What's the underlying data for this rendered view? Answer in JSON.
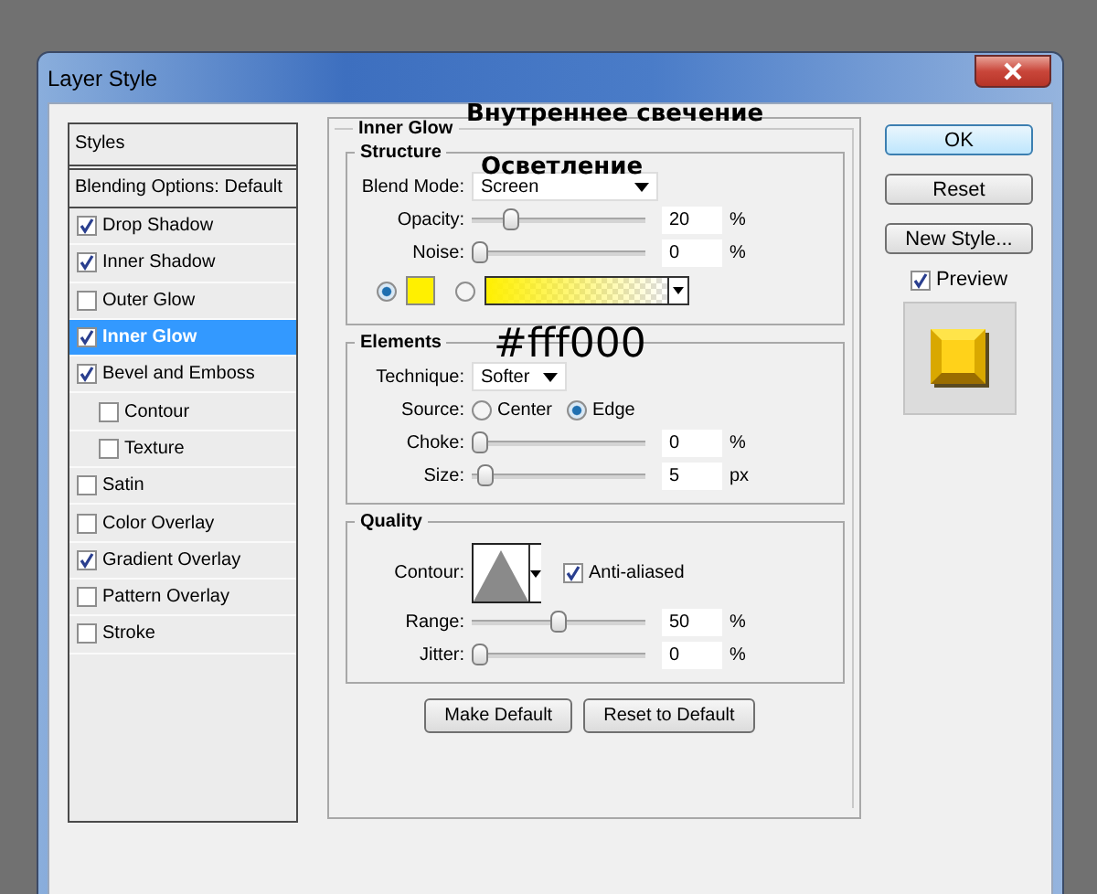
{
  "window": {
    "title": "Layer Style"
  },
  "styles_panel": {
    "header": "Styles",
    "blending_options": "Blending Options: Default",
    "items": [
      {
        "label": "Drop Shadow",
        "checked": true,
        "selected": false
      },
      {
        "label": "Inner Shadow",
        "checked": true,
        "selected": false
      },
      {
        "label": "Outer Glow",
        "checked": false,
        "selected": false
      },
      {
        "label": "Inner Glow",
        "checked": true,
        "selected": true
      },
      {
        "label": "Bevel and Emboss",
        "checked": true,
        "selected": false,
        "children": [
          {
            "label": "Contour",
            "checked": false,
            "selected": false
          },
          {
            "label": "Texture",
            "checked": false,
            "selected": false
          }
        ]
      },
      {
        "label": "Satin",
        "checked": false,
        "selected": false
      },
      {
        "label": "Color Overlay",
        "checked": false,
        "selected": false
      },
      {
        "label": "Gradient Overlay",
        "checked": true,
        "selected": false
      },
      {
        "label": "Pattern Overlay",
        "checked": false,
        "selected": false
      },
      {
        "label": "Stroke",
        "checked": false,
        "selected": false
      }
    ]
  },
  "inner_glow": {
    "title": "Inner Glow",
    "structure": {
      "title": "Structure",
      "blend_mode": {
        "label": "Blend Mode:",
        "value": "Screen"
      },
      "sliders": [
        {
          "label": "Opacity:",
          "level": 0.2,
          "value": "20",
          "unit": "%"
        },
        {
          "label": "Noise:",
          "level": 0,
          "value": "0",
          "unit": "%"
        }
      ],
      "fill_options": [
        {
          "kind": "color",
          "selected": true
        },
        {
          "kind": "gradient",
          "selected": false
        }
      ]
    },
    "elements": {
      "title": "Elements",
      "technique": {
        "label": "Technique:",
        "value": "Softer"
      },
      "source": {
        "label": "Source:",
        "options": [
          {
            "label": "Center",
            "selected": false
          },
          {
            "label": "Edge",
            "selected": true
          }
        ]
      },
      "sliders": [
        {
          "label": "Choke:",
          "level": 0,
          "value": "0",
          "unit": "%"
        },
        {
          "label": "Size:",
          "level": 0.03,
          "value": "5",
          "unit": "px"
        }
      ]
    },
    "quality": {
      "title": "Quality",
      "contour_label": "Contour:",
      "anti_aliased": {
        "label": "Anti-aliased",
        "checked": true
      },
      "sliders": [
        {
          "label": "Range:",
          "level": 0.5,
          "value": "50",
          "unit": "%"
        },
        {
          "label": "Jitter:",
          "level": 0,
          "value": "0",
          "unit": "%"
        }
      ]
    },
    "buttons": [
      "Make Default",
      "Reset to Default"
    ]
  },
  "side_buttons": [
    {
      "label": "OK",
      "focused": true
    },
    {
      "label": "Reset",
      "focused": false
    },
    {
      "label": "New Style...",
      "focused": false
    }
  ],
  "preview": {
    "label": "Preview",
    "checked": true
  },
  "annotations": [
    {
      "text": "Внутреннее свечение"
    },
    {
      "text": "Осветление"
    },
    {
      "text": "#fff000"
    }
  ]
}
